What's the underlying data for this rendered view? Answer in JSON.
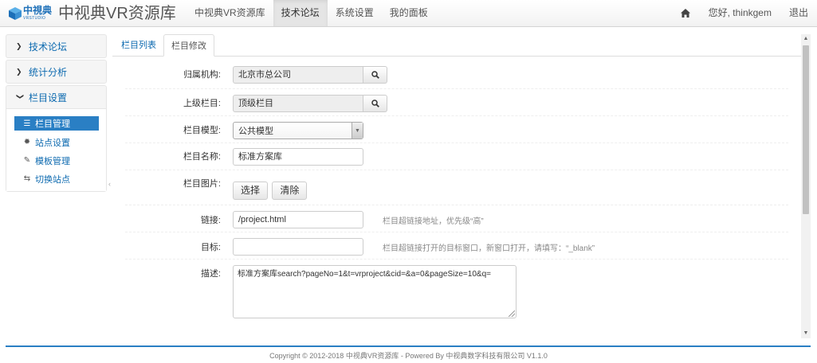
{
  "brand": {
    "logo_text": "中視典",
    "logo_sub": "VRSTUDIO",
    "title": "中视典VR资源库"
  },
  "nav": {
    "items": [
      {
        "label": "中视典VR资源库"
      },
      {
        "label": "技术论坛"
      },
      {
        "label": "系统设置"
      },
      {
        "label": "我的面板"
      }
    ],
    "active_index": 1,
    "greeting": "您好, thinkgem",
    "logout": "退出"
  },
  "sidebar": {
    "groups": [
      {
        "label": "技术论坛"
      },
      {
        "label": "统计分析"
      },
      {
        "label": "栏目设置"
      }
    ],
    "sub_items": [
      {
        "label": "栏目管理",
        "icon": "list-icon"
      },
      {
        "label": "站点设置",
        "icon": "gear-icon"
      },
      {
        "label": "模板管理",
        "icon": "pencil-icon"
      },
      {
        "label": "切换站点",
        "icon": "retweet-icon"
      }
    ]
  },
  "tabs": [
    {
      "label": "栏目列表"
    },
    {
      "label": "栏目修改"
    }
  ],
  "form": {
    "org": {
      "label": "归属机构:",
      "value": "北京市总公司"
    },
    "parent": {
      "label": "上级栏目:",
      "value": "顶级栏目"
    },
    "model": {
      "label": "栏目模型:",
      "value": "公共模型"
    },
    "name": {
      "label": "栏目名称:",
      "value": "标准方案库"
    },
    "image": {
      "label": "栏目图片:",
      "select_btn": "选择",
      "clear_btn": "清除"
    },
    "link": {
      "label": "链接:",
      "value": "/project.html",
      "help": "栏目超链接地址，优先级“高”"
    },
    "target": {
      "label": "目标:",
      "value": "",
      "help": "栏目超链接打开的目标窗口，新窗口打开，请填写：“_blank”"
    },
    "desc": {
      "label": "描述:",
      "value": "标准方案库search?pageNo=1&t=vrproject&cid=&a=0&pageSize=10&q="
    }
  },
  "footer": {
    "text": "Copyright © 2012-2018 中视典VR资源库 - Powered By 中视典数字科技有限公司 V1.1.0"
  },
  "colors": {
    "accent": "#2a7fc4",
    "link": "#0d6ab0"
  }
}
